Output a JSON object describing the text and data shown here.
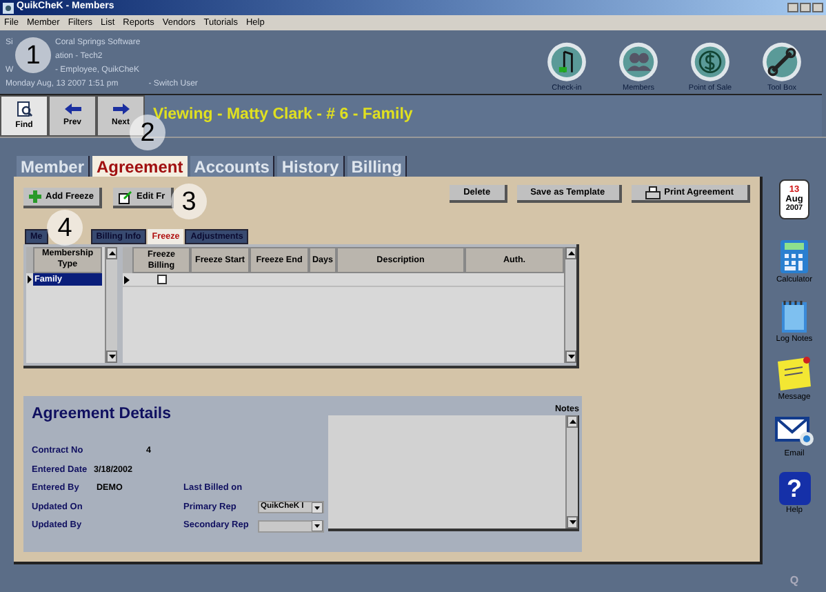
{
  "window": {
    "title": "QuikCheK - Members"
  },
  "menu": [
    "File",
    "Member",
    "Filters",
    "List",
    "Reports",
    "Vendors",
    "Tutorials",
    "Help"
  ],
  "info_lines": [
    {
      "start": "Si",
      "rest": "Coral Springs Software"
    },
    {
      "rest": "ation - Tech2"
    },
    {
      "start": "W",
      "rest": "- Employee, QuikCheK"
    }
  ],
  "date_line": "Monday Aug, 13 2007 1:51 pm",
  "switch_user": "- Switch User",
  "top_icons": [
    {
      "kind": "checkin",
      "label": "Check-in"
    },
    {
      "kind": "members",
      "label": "Members"
    },
    {
      "kind": "pos",
      "label": "Point of Sale"
    },
    {
      "kind": "tools",
      "label": "Tool Box"
    }
  ],
  "nav_buttons": [
    {
      "kind": "find",
      "label": "Find"
    },
    {
      "kind": "prev",
      "label": "Prev"
    },
    {
      "kind": "next",
      "label": "Next"
    }
  ],
  "viewing": "Viewing - Matty Clark - # 6 - Family",
  "tabs": [
    {
      "label": "Member",
      "selected": false
    },
    {
      "label": "Agreement",
      "selected": true
    },
    {
      "label": "Accounts",
      "selected": false
    },
    {
      "label": "History",
      "selected": false
    },
    {
      "label": "Billing",
      "selected": false
    }
  ],
  "left_buttons": [
    {
      "kind": "add",
      "label": "Add Freeze"
    },
    {
      "kind": "edit",
      "label": "Edit Fr"
    }
  ],
  "right_buttons": [
    {
      "kind": "plain",
      "label": "Delete"
    },
    {
      "kind": "plain",
      "label": "Save as Template"
    },
    {
      "kind": "print",
      "label": "Print Agreement"
    }
  ],
  "sub_tabs": [
    {
      "label": "Me",
      "selected": false
    },
    {
      "label": "Billing Info",
      "selected": false
    },
    {
      "label": "Freeze",
      "selected": true
    },
    {
      "label": "Adjustments",
      "selected": false
    }
  ],
  "membership_grid": {
    "column": "Membership Type",
    "rows": [
      {
        "value": "Family",
        "selected": true
      }
    ]
  },
  "freeze_grid": {
    "columns": [
      "Freeze Billing",
      "Freeze Start",
      "Freeze End",
      "Days",
      "Description",
      "Auth."
    ],
    "rows": [
      {
        "checked": false
      }
    ]
  },
  "details": {
    "title": "Agreement Details",
    "notes_label": "Notes",
    "left_fields": [
      {
        "label": "Contract No",
        "value": "4"
      },
      {
        "label": "Entered Date",
        "value": "3/18/2002"
      },
      {
        "label": "Entered By",
        "value": "DEMO"
      },
      {
        "label": "Updated On"
      },
      {
        "label": "Updated By"
      }
    ],
    "right_fields": [
      {
        "label": "Last Billed on",
        "kind": "text"
      },
      {
        "label": "Primary Rep",
        "kind": "select",
        "value": "QuikCheK I"
      },
      {
        "label": "Secondary Rep",
        "kind": "select"
      }
    ]
  },
  "calendar": {
    "day": "13",
    "month": "Aug",
    "year": "2007"
  },
  "side_icons": [
    {
      "kind": "calculator",
      "label": "Calculator"
    },
    {
      "kind": "notes",
      "label": "Log Notes"
    },
    {
      "kind": "message",
      "label": "Message"
    },
    {
      "kind": "email",
      "label": "Email"
    },
    {
      "kind": "help",
      "label": "Help",
      "glyph": "?"
    }
  ],
  "corner_mark": "Q",
  "callouts": [
    "1",
    "2",
    "3",
    "4"
  ]
}
